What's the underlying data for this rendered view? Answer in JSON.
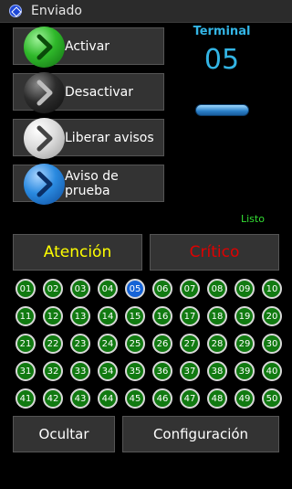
{
  "window": {
    "title": "Enviado",
    "icon": "app-icon"
  },
  "actions": [
    {
      "label": "Activar",
      "icon": "green-chevron-icon"
    },
    {
      "label": "Desactivar",
      "icon": "black-chevron-icon"
    },
    {
      "label": "Liberar avisos",
      "icon": "white-chevron-icon"
    },
    {
      "label": "Aviso de prueba",
      "icon": "blue-chevron-icon"
    }
  ],
  "terminal": {
    "label": "Terminal",
    "value": "05"
  },
  "status": "Listo",
  "alerts": {
    "atencion": "Atención",
    "critico": "Crítico"
  },
  "grid": {
    "selected": "05",
    "numbers": [
      "01",
      "02",
      "03",
      "04",
      "05",
      "06",
      "07",
      "08",
      "09",
      "10",
      "11",
      "12",
      "13",
      "14",
      "15",
      "16",
      "17",
      "18",
      "19",
      "20",
      "21",
      "22",
      "23",
      "24",
      "25",
      "26",
      "27",
      "28",
      "29",
      "30",
      "31",
      "32",
      "33",
      "34",
      "35",
      "36",
      "37",
      "38",
      "39",
      "40",
      "41",
      "42",
      "43",
      "44",
      "45",
      "46",
      "47",
      "48",
      "49",
      "50"
    ]
  },
  "bottom": {
    "ocultar": "Ocultar",
    "configuracion": "Configuración"
  },
  "colors": {
    "accent": "#33b5e5",
    "atencion": "#ffff00",
    "critico": "#e00000",
    "cell": "#117a11",
    "cell_selected": "#1563d6",
    "status": "#33dd33"
  }
}
